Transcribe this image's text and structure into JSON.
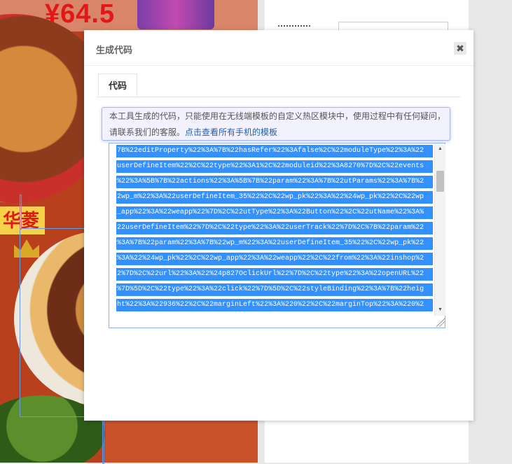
{
  "background": {
    "price": "¥64.5",
    "badge": "华菱"
  },
  "dialog": {
    "title": "生成代码",
    "close_label": "✖",
    "tabs": [
      {
        "label": "代码",
        "active": true
      }
    ],
    "notice": {
      "text": "本工具生成的代码，只能使用在无线端模板的自定义热区模块中，使用过程中有任何疑问，请联系我们的客服。",
      "link": "点击查看所有手机的模板"
    },
    "code_lines": [
      "7B%22editProperty%22%3A%7B%22hasRefer%22%3Afalse%2C%22moduleType%22%3A%22",
      "userDefineItem%22%2C%22type%22%3A1%2C%22moduleid%22%3A8270%7D%2C%22events",
      "%22%3A%5B%7B%22actions%22%3A%5B%7B%22param%22%3A%7B%22utParams%22%3A%7B%2",
      "2wp_m%22%3A%22userDefineItem_35%22%2C%22wp_pk%22%3A%22%24wp_pk%22%2C%22wp",
      "_app%22%3A%22weapp%22%7D%2C%22utType%22%3A%22Button%22%2C%22utName%22%3A%",
      "22userDefineItem%22%7D%2C%22type%22%3A%22userTrack%22%7D%2C%7B%22param%22",
      "%3A%7B%22param%22%3A%7B%22wp_m%22%3A%22userDefineItem_35%22%2C%22wp_pk%22",
      "%3A%22%24wp_pk%22%2C%22wp_app%22%3A%22weapp%22%2C%22from%22%3A%22inshop%2",
      "2%7D%2C%22url%22%3A%22%24p827OclickUrl%22%7D%2C%22type%22%3A%22openURL%22",
      "%7D%5D%2C%22type%22%3A%22click%22%7D%5D%2C%22styleBinding%22%3A%7B%22heig",
      "ht%22%3A%22936%22%2C%22marginLeft%22%3A%220%22%2C%22marginTop%22%3A%220%2"
    ],
    "scroll_up": "▲",
    "scroll_down": "▼"
  }
}
